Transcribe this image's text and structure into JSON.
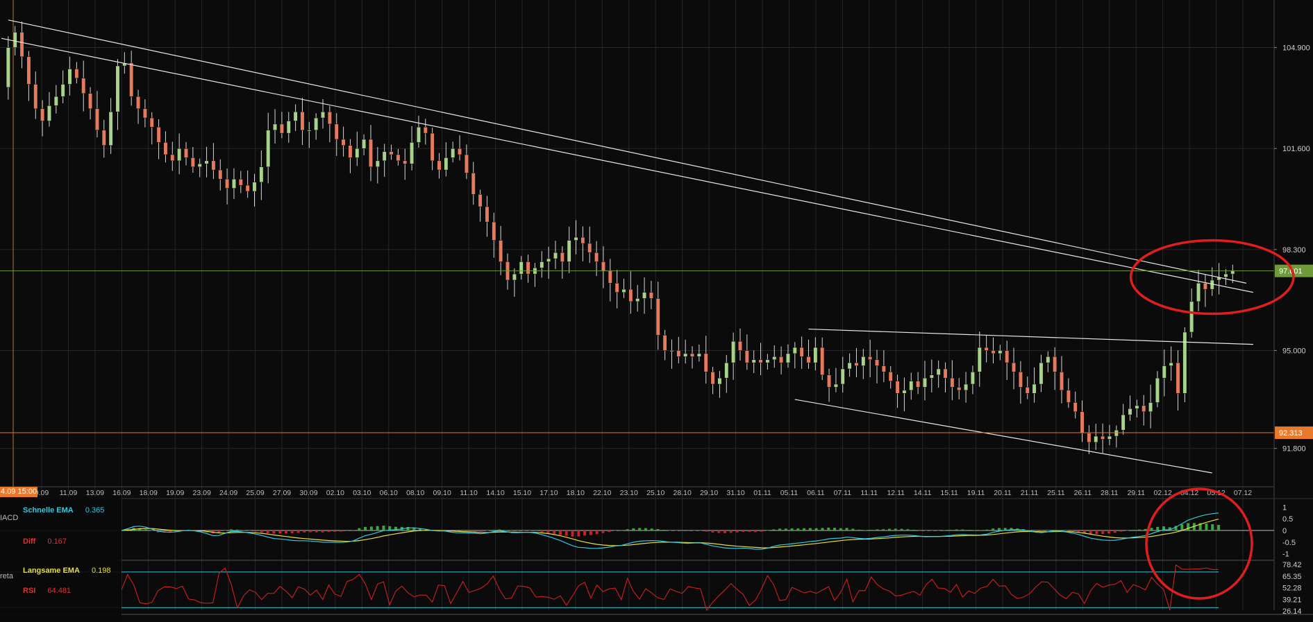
{
  "colors": {
    "background": "#0b0b0b",
    "grid": "#262626",
    "up": "#a8d38a",
    "down": "#e57a5c",
    "trendline": "#e8e8e8",
    "marker_current": "#6f9a3a",
    "marker_level": "#e8792a",
    "macd_fast": "#33c9e0",
    "macd_slow": "#e8e03a",
    "hist_up": "#3fa33f",
    "hist_down": "#c8202a",
    "rsi": "#d21f1f",
    "rsi_band": "#33c9e0",
    "annotation": "#e01e1e"
  },
  "chart_data": {
    "type": "line",
    "price_axis": {
      "ticks": [
        "104.900",
        "101.600",
        "98.300",
        "95.000",
        "91.800"
      ],
      "tick_values": [
        104.9,
        101.6,
        98.3,
        95.0,
        91.8
      ]
    },
    "current_price": {
      "label": "97.601",
      "value": 97.601
    },
    "level_price": {
      "label": "92.313",
      "value": 92.313
    },
    "cursor_time": "4.09 15:00",
    "x_labels": [
      "0.09",
      "11.09",
      "13.09",
      "16.09",
      "18.09",
      "19.09",
      "23.09",
      "24.09",
      "25.09",
      "27.09",
      "30.09",
      "02.10",
      "03.10",
      "06.10",
      "08.10",
      "09.10",
      "11.10",
      "14.10",
      "15.10",
      "17.10",
      "18.10",
      "22.10",
      "23.10",
      "25.10",
      "28.10",
      "29.10",
      "31.10",
      "01.11",
      "05.11",
      "06.11",
      "07.11",
      "11.11",
      "12.11",
      "14.11",
      "15.11",
      "19.11",
      "20.11",
      "21.11",
      "25.11",
      "26.11",
      "28.11",
      "29.11",
      "02.12",
      "04.12",
      "05.12",
      "07.12"
    ],
    "price_path": [
      [
        0,
        103.6
      ],
      [
        1,
        104.9
      ],
      [
        2,
        105.4
      ],
      [
        3,
        104.6
      ],
      [
        4,
        103.7
      ],
      [
        5,
        102.9
      ],
      [
        6,
        102.5
      ],
      [
        7,
        103.0
      ],
      [
        8,
        103.3
      ],
      [
        9,
        103.7
      ],
      [
        10,
        104.2
      ],
      [
        11,
        103.9
      ],
      [
        12,
        103.4
      ],
      [
        13,
        102.9
      ],
      [
        14,
        102.2
      ],
      [
        15,
        101.7
      ],
      [
        16,
        102.8
      ],
      [
        17,
        104.3
      ],
      [
        18,
        104.4
      ],
      [
        19,
        103.3
      ],
      [
        20,
        102.9
      ],
      [
        21,
        102.6
      ],
      [
        22,
        102.3
      ],
      [
        23,
        101.8
      ],
      [
        24,
        101.4
      ],
      [
        25,
        101.2
      ],
      [
        26,
        101.6
      ],
      [
        27,
        101.3
      ],
      [
        28,
        101.0
      ],
      [
        29,
        101.1
      ],
      [
        30,
        101.2
      ],
      [
        31,
        100.9
      ],
      [
        32,
        100.6
      ],
      [
        33,
        100.3
      ],
      [
        34,
        100.6
      ],
      [
        35,
        100.4
      ],
      [
        36,
        100.2
      ],
      [
        37,
        100.5
      ],
      [
        38,
        101.0
      ],
      [
        39,
        102.2
      ],
      [
        40,
        102.4
      ],
      [
        41,
        102.1
      ],
      [
        42,
        102.5
      ],
      [
        43,
        102.8
      ],
      [
        44,
        102.2
      ],
      [
        45,
        102.2
      ],
      [
        46,
        102.6
      ],
      [
        47,
        102.8
      ],
      [
        48,
        102.4
      ],
      [
        49,
        101.9
      ],
      [
        50,
        101.7
      ],
      [
        51,
        101.3
      ],
      [
        52,
        101.6
      ],
      [
        53,
        101.9
      ],
      [
        54,
        101.0
      ],
      [
        55,
        101.2
      ],
      [
        56,
        101.5
      ],
      [
        57,
        101.4
      ],
      [
        58,
        101.2
      ],
      [
        59,
        101.1
      ],
      [
        60,
        101.8
      ],
      [
        61,
        102.3
      ],
      [
        62,
        102.1
      ],
      [
        63,
        101.2
      ],
      [
        64,
        100.9
      ],
      [
        65,
        101.3
      ],
      [
        66,
        101.6
      ],
      [
        67,
        101.4
      ],
      [
        68,
        100.8
      ],
      [
        69,
        100.1
      ],
      [
        70,
        99.7
      ],
      [
        71,
        99.2
      ],
      [
        72,
        98.6
      ],
      [
        73,
        97.9
      ],
      [
        74,
        97.3
      ],
      [
        75,
        97.5
      ],
      [
        76,
        97.9
      ],
      [
        77,
        97.5
      ],
      [
        78,
        97.7
      ],
      [
        79,
        97.9
      ],
      [
        80,
        98.0
      ],
      [
        81,
        98.2
      ],
      [
        82,
        97.9
      ],
      [
        83,
        98.6
      ],
      [
        84,
        98.7
      ],
      [
        85,
        98.5
      ],
      [
        86,
        98.2
      ],
      [
        87,
        97.9
      ],
      [
        88,
        97.6
      ],
      [
        89,
        97.2
      ],
      [
        90,
        96.9
      ],
      [
        91,
        97.0
      ],
      [
        92,
        96.6
      ],
      [
        93,
        96.7
      ],
      [
        94,
        96.9
      ],
      [
        95,
        96.7
      ],
      [
        96,
        95.5
      ],
      [
        97,
        95.0
      ],
      [
        98,
        95.0
      ],
      [
        99,
        94.8
      ],
      [
        100,
        94.9
      ],
      [
        101,
        94.8
      ],
      [
        102,
        94.9
      ],
      [
        103,
        94.3
      ],
      [
        104,
        93.9
      ],
      [
        105,
        94.1
      ],
      [
        106,
        94.6
      ],
      [
        107,
        95.3
      ],
      [
        108,
        95.0
      ],
      [
        109,
        94.6
      ],
      [
        110,
        94.7
      ],
      [
        111,
        94.6
      ],
      [
        112,
        94.7
      ],
      [
        113,
        94.8
      ],
      [
        114,
        94.6
      ],
      [
        115,
        94.9
      ],
      [
        116,
        95.1
      ],
      [
        117,
        94.8
      ],
      [
        118,
        94.6
      ],
      [
        119,
        95.1
      ],
      [
        120,
        94.2
      ],
      [
        121,
        93.8
      ],
      [
        122,
        93.9
      ],
      [
        123,
        94.4
      ],
      [
        124,
        94.6
      ],
      [
        125,
        94.5
      ],
      [
        126,
        94.8
      ],
      [
        127,
        94.7
      ],
      [
        128,
        94.5
      ],
      [
        129,
        94.3
      ],
      [
        130,
        94.0
      ],
      [
        131,
        93.6
      ],
      [
        132,
        93.7
      ],
      [
        133,
        94.0
      ],
      [
        134,
        93.8
      ],
      [
        135,
        94.1
      ],
      [
        136,
        94.2
      ],
      [
        137,
        94.4
      ],
      [
        138,
        94.1
      ],
      [
        139,
        93.8
      ],
      [
        140,
        93.7
      ],
      [
        141,
        93.9
      ],
      [
        142,
        94.3
      ],
      [
        143,
        95.1
      ],
      [
        144,
        95.0
      ],
      [
        145,
        94.9
      ],
      [
        146,
        95.0
      ],
      [
        147,
        94.6
      ],
      [
        148,
        94.3
      ],
      [
        149,
        93.8
      ],
      [
        150,
        93.6
      ],
      [
        151,
        93.9
      ],
      [
        152,
        94.6
      ],
      [
        153,
        94.8
      ],
      [
        154,
        94.3
      ],
      [
        155,
        93.7
      ],
      [
        156,
        93.3
      ],
      [
        157,
        93.0
      ],
      [
        158,
        92.3
      ],
      [
        159,
        92.0
      ],
      [
        160,
        92.2
      ],
      [
        161,
        92.1
      ],
      [
        162,
        92.2
      ],
      [
        163,
        92.4
      ],
      [
        164,
        92.9
      ],
      [
        165,
        93.1
      ],
      [
        166,
        93.2
      ],
      [
        167,
        93.0
      ],
      [
        168,
        93.3
      ],
      [
        169,
        94.1
      ],
      [
        170,
        94.5
      ],
      [
        171,
        94.6
      ],
      [
        172,
        93.6
      ],
      [
        173,
        95.6
      ],
      [
        174,
        96.6
      ],
      [
        175,
        97.2
      ],
      [
        176,
        97.0
      ],
      [
        177,
        97.3
      ],
      [
        178,
        97.4
      ],
      [
        179,
        97.5
      ],
      [
        180,
        97.6
      ]
    ],
    "trendlines": [
      {
        "from": [
          1,
          105.8
        ],
        "to": [
          182,
          97.2
        ]
      },
      {
        "from": [
          0,
          105.2
        ],
        "to": [
          183,
          96.9
        ]
      },
      {
        "from": [
          118,
          95.7
        ],
        "to": [
          183,
          95.2
        ]
      },
      {
        "from": [
          116,
          93.4
        ],
        "to": [
          177,
          91.0
        ]
      }
    ],
    "annotations": [
      {
        "type": "circle",
        "at": [
          177,
          97.4
        ],
        "rx": 8.2,
        "ry": 1.2
      }
    ]
  },
  "macd": {
    "ticks": [
      "1",
      "0.5",
      "0",
      "-0.5",
      "-1"
    ],
    "fast": {
      "label": "Schnelle EMA",
      "value": "0.365"
    },
    "diff": {
      "label": "Diff",
      "value": "0.167"
    },
    "slow": {
      "label": "Langsame EMA",
      "value": "0.198"
    },
    "stub_text": "IACD"
  },
  "rsi": {
    "ticks": [
      "78.42",
      "65.35",
      "52.28",
      "39.21",
      "26.14"
    ],
    "value_label": "RSI",
    "value": "64.481",
    "stub_text": "reta"
  }
}
